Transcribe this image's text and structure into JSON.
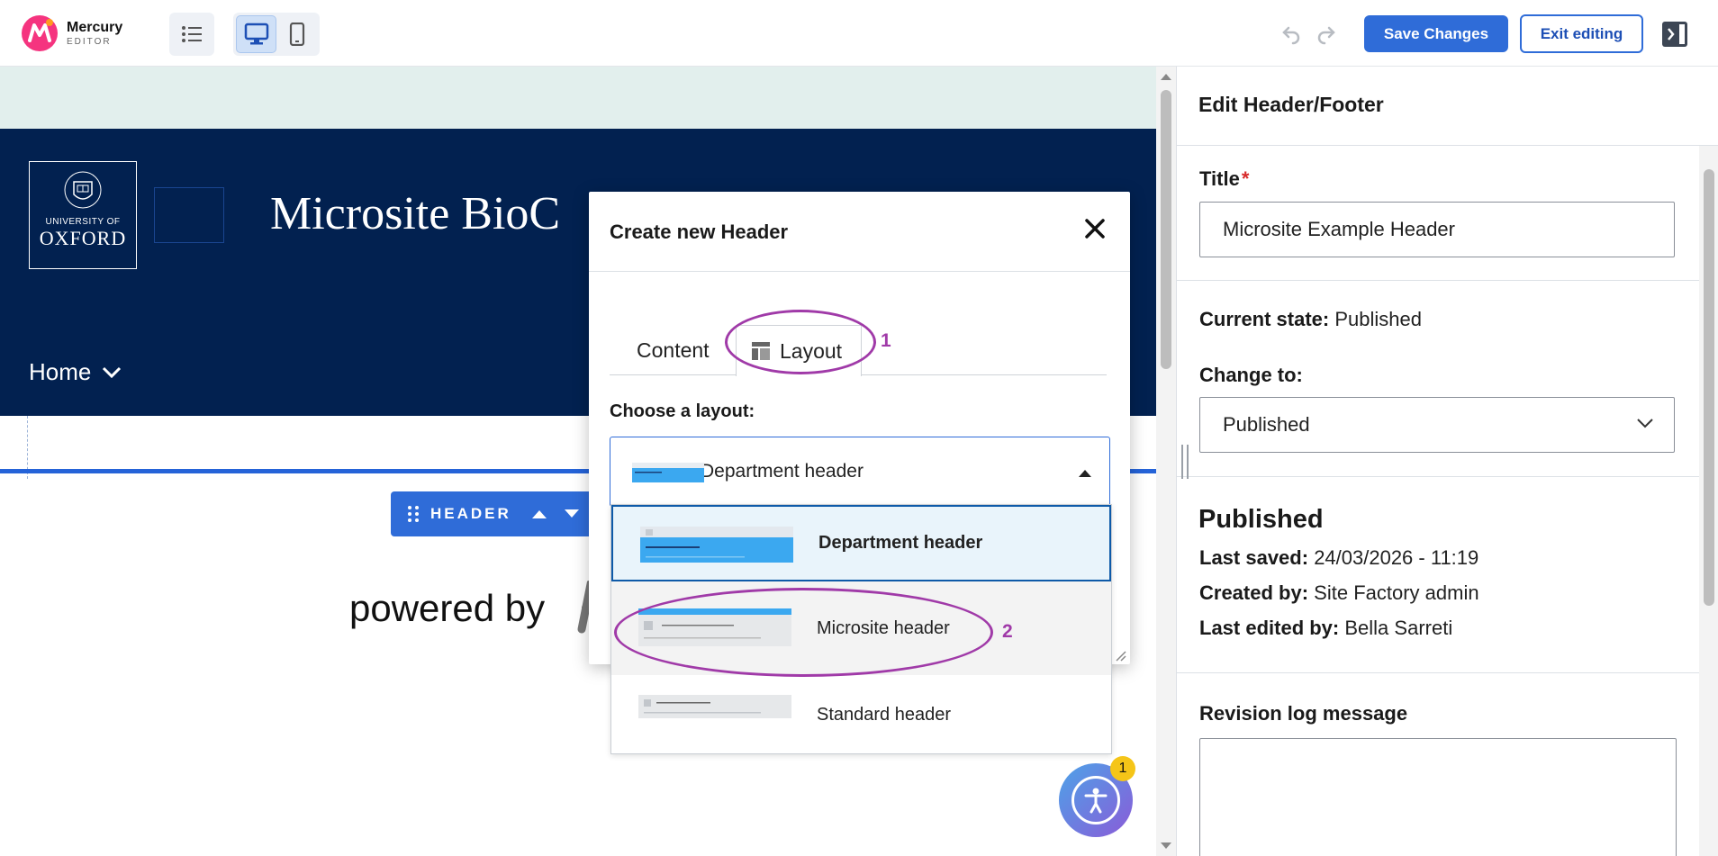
{
  "toolbar": {
    "logo_name": "Mercury",
    "logo_sub": "EDITOR",
    "save_label": "Save Changes",
    "exit_label": "Exit editing"
  },
  "preview": {
    "site_title": "Microsite BioC",
    "brand_line1": "UNIVERSITY OF",
    "brand_line2": "OXFORD",
    "nav_home": "Home",
    "header_chip": "HEADER",
    "powered_by": "powered by"
  },
  "modal": {
    "title": "Create new Header",
    "tabs": [
      {
        "label": "Content"
      },
      {
        "label": "Layout"
      }
    ],
    "choose_label": "Choose a layout:",
    "selected": "Department header",
    "options": [
      {
        "label": "Department header"
      },
      {
        "label": "Microsite header"
      },
      {
        "label": "Standard header"
      }
    ]
  },
  "annotations": [
    "1",
    "2"
  ],
  "sidebar": {
    "title": "Edit Header/Footer",
    "title_label": "Title",
    "title_value": "Microsite Example Header",
    "current_state_label": "Current state:",
    "current_state_value": "Published",
    "change_to_label": "Change to:",
    "change_to_value": "Published",
    "status_heading": "Published",
    "last_saved_label": "Last saved:",
    "last_saved_value": "24/03/2026 - 11:19",
    "created_by_label": "Created by:",
    "created_by_value": "Site Factory admin",
    "last_edited_label": "Last edited by:",
    "last_edited_value": "Bella Sarreti",
    "revision_label": "Revision log message"
  },
  "accessibility": {
    "badge": "1"
  },
  "colors": {
    "accent": "#2f6cd8",
    "site_header_bg": "#022150",
    "annotation": "#a03aa8"
  }
}
